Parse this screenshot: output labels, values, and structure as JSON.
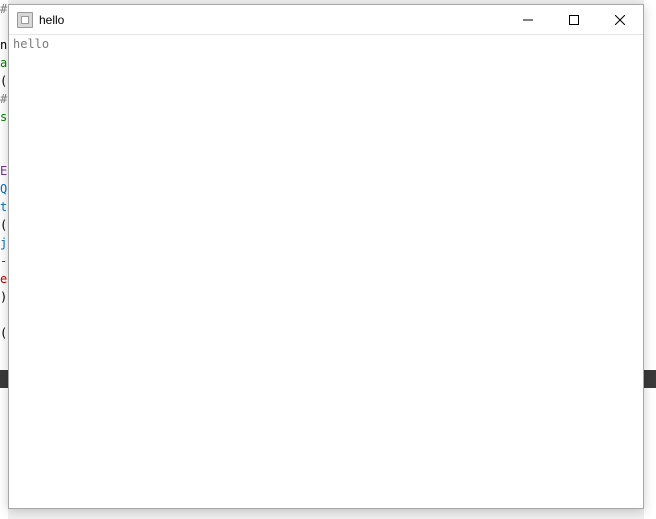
{
  "window": {
    "title": "hello"
  },
  "content": {
    "text": "hello"
  },
  "bg": {
    "l1": "#",
    "l2": " ",
    "l3": "n",
    "l4": "a",
    "l5": "(",
    "l6": "#",
    "l7": "s",
    "l8": " ",
    "l9": " ",
    "l10": "E",
    "l11": "Q",
    "l12": "t",
    "l13": "(",
    "l14": "j",
    "l15": "-",
    "l16": "e",
    "l17": ")",
    "l18": " ",
    "l19": "("
  }
}
